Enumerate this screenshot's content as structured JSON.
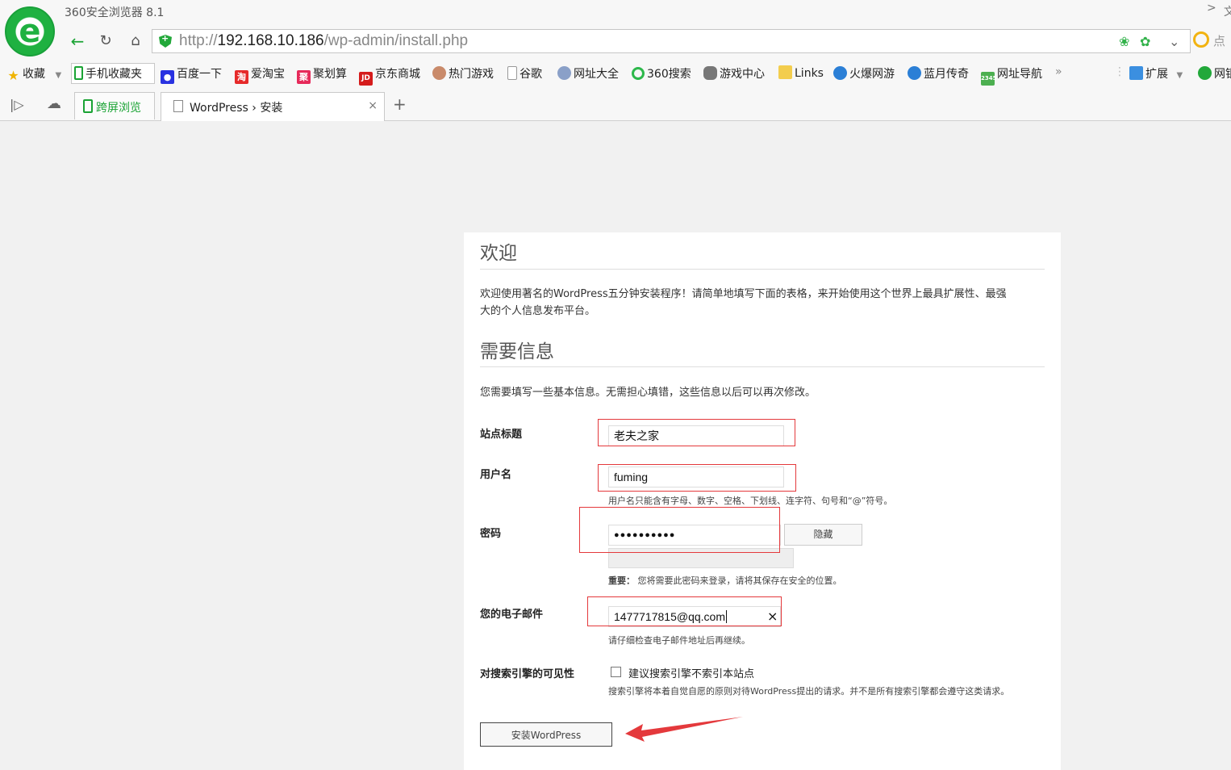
{
  "window": {
    "title": "360安全浏览器 8.1",
    "logo_letter": "e",
    "right_chevron": ">",
    "right_text": "文"
  },
  "address_bar": {
    "url_prefix": "http://",
    "url_host": "192.168.10.186",
    "url_path": "/wp-admin/install.php",
    "search_text": "点"
  },
  "bookmarks": {
    "items": [
      {
        "label": "收藏",
        "icon": "star-icon"
      },
      {
        "label": "手机收藏夹",
        "icon": "mobile-icon"
      },
      {
        "label": "百度一下",
        "icon": "baidu-icon"
      },
      {
        "label": "爱淘宝",
        "icon": "taobao-icon",
        "glyph": "淘"
      },
      {
        "label": "聚划算",
        "icon": "juhuasuan-icon",
        "glyph": "聚"
      },
      {
        "label": "京东商城",
        "icon": "jd-icon",
        "glyph": "JD"
      },
      {
        "label": "热门游戏",
        "icon": "game-avatar-icon"
      },
      {
        "label": "谷歌",
        "icon": "page-icon"
      },
      {
        "label": "网址大全",
        "icon": "globe-icon"
      },
      {
        "label": "360搜索",
        "icon": "360-search-icon"
      },
      {
        "label": "游戏中心",
        "icon": "gamepad-icon"
      },
      {
        "label": "Links",
        "icon": "folder-icon"
      },
      {
        "label": "火爆网游",
        "icon": "penguin-icon"
      },
      {
        "label": "蓝月传奇",
        "icon": "penguin-icon"
      },
      {
        "label": "网址导航",
        "icon": "house-icon",
        "glyph": "2345"
      }
    ],
    "more": "»",
    "extension_label": "扩展",
    "truncated_label": "网银"
  },
  "tabs": {
    "kuaping_label": "跨屏浏览",
    "active_label": "WordPress › 安装",
    "close": "×",
    "new_tab": "+"
  },
  "page": {
    "welcome_heading": "欢迎",
    "welcome_text_1": "欢迎使用著名的WordPress五分钟安装程序！请简单地填写下面的表格，来开始使用这个世界上最具扩展性、最强",
    "welcome_text_2": "大的个人信息发布平台。",
    "info_heading": "需要信息",
    "info_text": "您需要填写一些基本信息。无需担心填错，这些信息以后可以再次修改。",
    "site_title_label": "站点标题",
    "site_title_value": "老夫之家",
    "username_label": "用户名",
    "username_value": "fuming",
    "username_hint": "用户名只能含有字母、数字、空格、下划线、连字符、句号和“@”符号。",
    "password_label": "密码",
    "password_value": "●●●●●●●●●●",
    "hide_button": "隐藏",
    "password_important_bold": "重要：",
    "password_important_text": "您将需要此密码来登录，请将其保存在安全的位置。",
    "email_label": "您的电子邮件",
    "email_value": "1477717815@qq.com",
    "email_clear": "×",
    "email_hint": "请仔细检查电子邮件地址后再继续。",
    "search_visibility_label": "对搜索引擎的可见性",
    "search_checkbox_label": "建议搜索引擎不索引本站点",
    "search_hint": "搜索引擎将本着自觉自愿的原则对待WordPress提出的请求。并不是所有搜索引擎都会遵守这类请求。",
    "install_button": "安装WordPress",
    "search_discourage_checked": false
  },
  "colors": {
    "brand_green": "#1fb141",
    "annotation_red": "#e4393c"
  }
}
